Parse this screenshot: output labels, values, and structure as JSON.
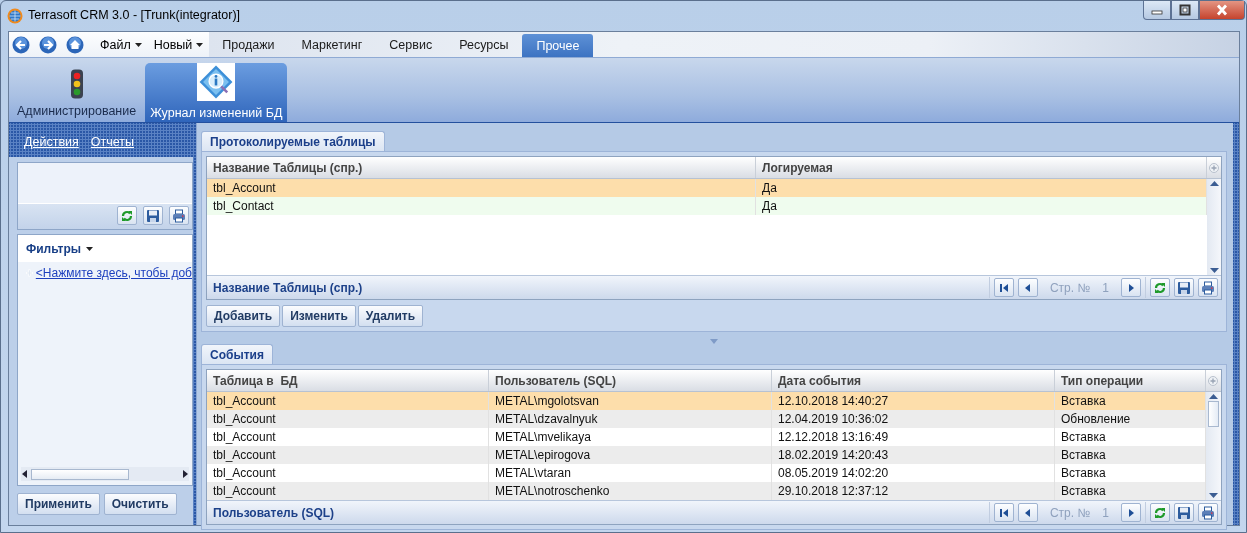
{
  "window": {
    "title": "Terrasoft CRM 3.0 - [Trunk(integrator)]"
  },
  "menu_bar": {
    "menus": [
      {
        "label": "Файл"
      },
      {
        "label": "Новый"
      }
    ],
    "tabs": [
      {
        "label": "Продажи",
        "selected": false
      },
      {
        "label": "Маркетинг",
        "selected": false
      },
      {
        "label": "Сервис",
        "selected": false
      },
      {
        "label": "Ресурсы",
        "selected": false
      },
      {
        "label": "Прочее",
        "selected": true
      }
    ]
  },
  "ribbon": {
    "items": [
      {
        "label": "Администрирование",
        "kind": "traffic-light",
        "selected": false
      },
      {
        "label": "Журнал изменений БД",
        "kind": "db-journal",
        "selected": true
      }
    ]
  },
  "sidebar": {
    "links": [
      "Действия",
      "Отчеты"
    ],
    "filters": {
      "title": "Фильтры",
      "add_link": "<Нажмите здесь, чтобы доб"
    },
    "buttons": [
      "Применить",
      "Очистить"
    ]
  },
  "tables_panel": {
    "tab": {
      "label": "Протоколируемые таблицы",
      "selected": true
    },
    "columns": [
      "Название Таблицы (спр.)",
      "Логируемая"
    ],
    "rows": [
      {
        "cells": [
          "tbl_Account",
          "Да"
        ],
        "selected": true
      },
      {
        "cells": [
          "tbl_Contact",
          "Да"
        ],
        "selected": false
      }
    ],
    "footer": "Название Таблицы (спр.)",
    "pager": {
      "label": "Стр. №",
      "page": "1"
    },
    "buttons": [
      "Добавить",
      "Изменить",
      "Удалить"
    ]
  },
  "events_panel": {
    "tab": {
      "label": "События",
      "selected": true
    },
    "columns": [
      "Таблица в  БД",
      "Пользователь (SQL)",
      "Дата события",
      "Тип операции"
    ],
    "rows": [
      {
        "cells": [
          "tbl_Account",
          "METAL\\mgolotsvan",
          "12.10.2018 14:40:27",
          "Вставка"
        ],
        "selected": true
      },
      {
        "cells": [
          "tbl_Account",
          "METAL\\dzavalnyuk",
          "12.04.2019 10:36:02",
          "Обновление"
        ],
        "selected": false
      },
      {
        "cells": [
          "tbl_Account",
          "METAL\\mvelikaya",
          "12.12.2018 13:16:49",
          "Вставка"
        ],
        "selected": false
      },
      {
        "cells": [
          "tbl_Account",
          "METAL\\epirogova",
          "18.02.2019 14:20:43",
          "Вставка"
        ],
        "selected": false
      },
      {
        "cells": [
          "tbl_Account",
          "METAL\\vtaran",
          "08.05.2019 14:02:20",
          "Вставка"
        ],
        "selected": false
      },
      {
        "cells": [
          "tbl_Account",
          "METAL\\notroschenko",
          "29.10.2018 12:37:12",
          "Вставка"
        ],
        "selected": false
      }
    ],
    "footer": "Пользователь (SQL)",
    "pager": {
      "label": "Стр. №",
      "page": "1"
    }
  }
}
